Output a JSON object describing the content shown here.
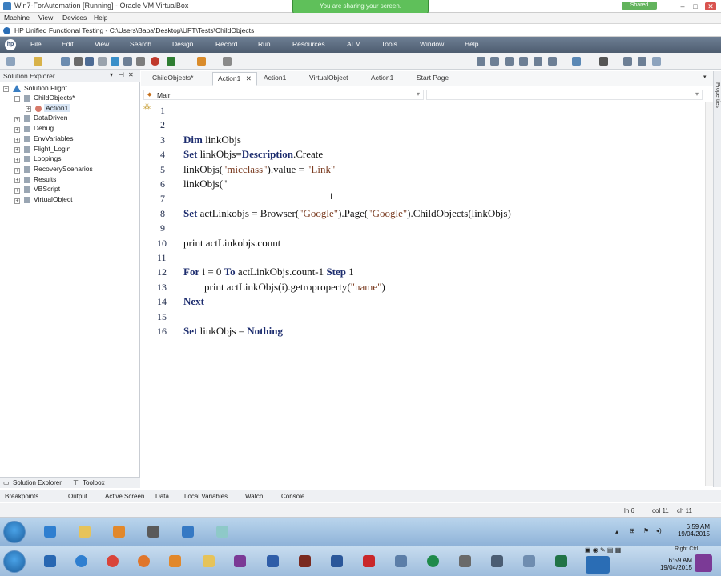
{
  "vbox": {
    "title": "Win7-ForAutomation [Running] - Oracle VM VirtualBox",
    "share_banner": "You are sharing your screen.",
    "shared_badge": "Shared",
    "menu": [
      "Machine",
      "View",
      "Devices",
      "Help"
    ]
  },
  "uft": {
    "title": "HP Unified Functional Testing - C:\\Users\\Baba\\Desktop\\UFT\\Tests\\ChildObjects",
    "logo": "hp",
    "menu": [
      "File",
      "Edit",
      "View",
      "Search",
      "Design",
      "Record",
      "Run",
      "Resources",
      "ALM",
      "Tools",
      "Window",
      "Help"
    ]
  },
  "solution": {
    "header": "Solution Explorer",
    "root": "Solution Flight",
    "items": [
      "ChildObjects*",
      "Action1",
      "DataDriven",
      "Debug",
      "EnvVariables",
      "Flight_Login",
      "Loopings",
      "RecoveryScenarios",
      "Results",
      "VBScript",
      "VirtualObject"
    ],
    "tabs": [
      "Solution Explorer",
      "Toolbox"
    ]
  },
  "doc_tabs": [
    "ChildObjects*",
    "Action1",
    "Action1",
    "VirtualObject",
    "Action1",
    "Start Page"
  ],
  "action_combo": "Main",
  "code": {
    "lines": [
      {
        "n": "1",
        "parts": []
      },
      {
        "n": "2",
        "parts": []
      },
      {
        "n": "3",
        "parts": [
          {
            "t": "Dim",
            "k": "kw"
          },
          {
            "t": " linkObjs"
          }
        ]
      },
      {
        "n": "4",
        "parts": [
          {
            "t": "Set",
            "k": "kw"
          },
          {
            "t": " linkObjs="
          },
          {
            "t": "Description",
            "k": "kw"
          },
          {
            "t": ".Create"
          }
        ]
      },
      {
        "n": "5",
        "parts": [
          {
            "t": "linkObjs("
          },
          {
            "t": "\"micclass\"",
            "k": "str"
          },
          {
            "t": ").value = "
          },
          {
            "t": "\"Link\"",
            "k": "str"
          }
        ]
      },
      {
        "n": "6",
        "parts": [
          {
            "t": "linkObjs(\""
          }
        ]
      },
      {
        "n": "7",
        "parts": []
      },
      {
        "n": "8",
        "parts": [
          {
            "t": "Set",
            "k": "kw"
          },
          {
            "t": " actLinkobjs = Browser("
          },
          {
            "t": "\"Google\"",
            "k": "str"
          },
          {
            "t": ").Page("
          },
          {
            "t": "\"Google\"",
            "k": "str"
          },
          {
            "t": ").ChildObjects(linkObjs)"
          }
        ]
      },
      {
        "n": "9",
        "parts": []
      },
      {
        "n": "10",
        "parts": [
          {
            "t": "print actLinkobjs.count"
          }
        ]
      },
      {
        "n": "11",
        "parts": []
      },
      {
        "n": "12",
        "parts": [
          {
            "t": "For",
            "k": "kw"
          },
          {
            "t": " i = 0 "
          },
          {
            "t": "To",
            "k": "kw"
          },
          {
            "t": " actLinkObjs.count-1 "
          },
          {
            "t": "Step",
            "k": "kw"
          },
          {
            "t": " 1"
          }
        ]
      },
      {
        "n": "13",
        "parts": [
          {
            "t": "        print actLinkObjs(i).getroproperty("
          },
          {
            "t": "\"name\"",
            "k": "str"
          },
          {
            "t": ")"
          }
        ]
      },
      {
        "n": "14",
        "parts": [
          {
            "t": "Next",
            "k": "kw"
          }
        ]
      },
      {
        "n": "15",
        "parts": []
      },
      {
        "n": "16",
        "parts": [
          {
            "t": "Set",
            "k": "kw"
          },
          {
            "t": " linkObjs = "
          },
          {
            "t": "Nothing",
            "k": "kw"
          }
        ]
      }
    ]
  },
  "bottom_tabs": [
    "Breakpoints",
    "Output",
    "Active Screen",
    "Data",
    "Local Variables",
    "Watch",
    "Console"
  ],
  "status": {
    "ln": "ln 6",
    "col": "col 11",
    "ch": "ch 11"
  },
  "clock1": {
    "time": "6:59 AM",
    "date": "19/04/2015"
  },
  "clock2": {
    "time": "6:59 AM",
    "date": "19/04/2015"
  },
  "right_ctrl": "Right Ctrl",
  "properties_label": "Properties",
  "colors": {
    "menu_bar": "#5a6a7e",
    "keyword": "#1c2c6e",
    "string": "#7a3b20",
    "share_green": "#5fc05a"
  }
}
